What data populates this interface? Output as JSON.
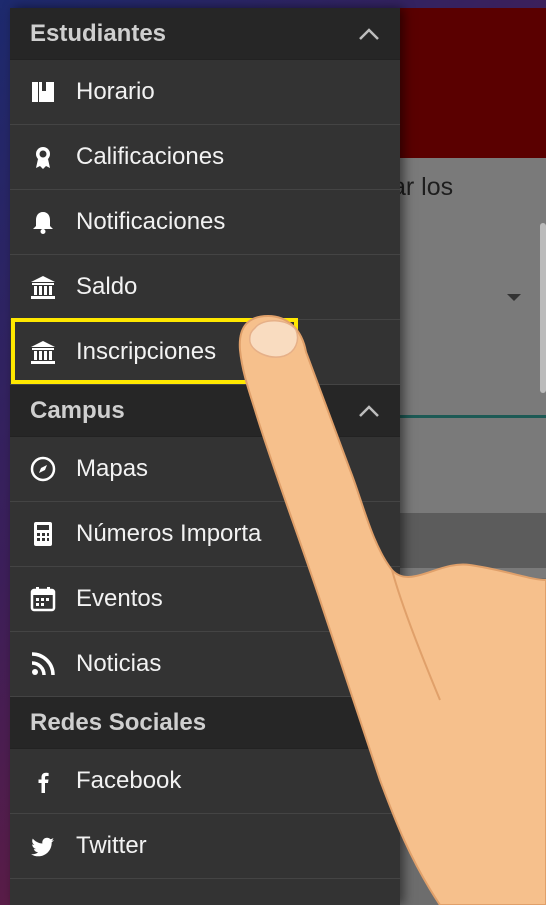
{
  "app_background": {
    "partial_text": "ar los"
  },
  "drawer": {
    "sections": [
      {
        "title": "Estudiantes",
        "items": [
          {
            "label": "Horario",
            "icon": "book-icon"
          },
          {
            "label": "Calificaciones",
            "icon": "award-icon"
          },
          {
            "label": "Notificaciones",
            "icon": "bell-icon"
          },
          {
            "label": "Saldo",
            "icon": "bank-icon"
          },
          {
            "label": "Inscripciones",
            "icon": "bank-icon"
          }
        ]
      },
      {
        "title": "Campus",
        "items": [
          {
            "label": "Mapas",
            "icon": "compass-icon"
          },
          {
            "label": "Números Importa",
            "icon": "calculator-icon"
          },
          {
            "label": "Eventos",
            "icon": "calendar-icon"
          },
          {
            "label": "Noticias",
            "icon": "rss-icon"
          }
        ]
      },
      {
        "title": "Redes Sociales",
        "items": [
          {
            "label": "Facebook",
            "icon": "facebook-icon"
          },
          {
            "label": "Twitter",
            "icon": "twitter-icon"
          }
        ]
      }
    ]
  },
  "colors": {
    "drawer_bg": "#333333",
    "section_bg": "#262626",
    "highlight": "#ffe800",
    "header_red": "#5a0000"
  }
}
